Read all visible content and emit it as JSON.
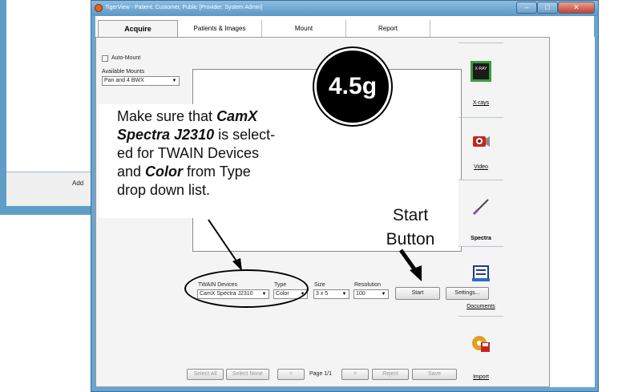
{
  "background_window": {
    "button_label": "Add"
  },
  "window": {
    "title": "TigerView - Patient: Customer, Public [Provider: System Admin]",
    "min": "–",
    "max": "□",
    "close": "✕"
  },
  "tabs": [
    "Acquire",
    "Patients & Images",
    "Mount",
    "Report"
  ],
  "left_panel": {
    "auto_mount": "Auto-Mount",
    "available_mounts_label": "Available Mounts",
    "available_mounts_value": "Pan and 4 BWX"
  },
  "controls": {
    "twain_label": "TWAIN Devices",
    "twain_value": "CamX Spectra J2310",
    "type_label": "Type",
    "type_value": "Color",
    "size_label": "Size",
    "size_value": "3 x 5",
    "resolution_label": "Resolution",
    "resolution_value": "100",
    "start": "Start",
    "settings": "Settings..."
  },
  "footer": {
    "select_all": "Select All",
    "select_none": "Select None",
    "prev": "<",
    "page": "Page 1/1",
    "next": ">",
    "reject": "Reject",
    "save": "Save"
  },
  "sidebar": {
    "xrays": "X-rays",
    "xray_icon_text": "X-RAY",
    "video": "Video",
    "spectra": "Spectra",
    "documents": "Documents",
    "import": "Import"
  },
  "annotation": {
    "badge": "4.5g",
    "lines": [
      [
        "Make sure that ",
        "CamX"
      ],
      [
        "Spectra J2310",
        " is select-"
      ],
      [
        "ed for TWAIN Devices",
        ""
      ],
      [
        "and ",
        "Color",
        " from Type"
      ],
      [
        "drop down list.",
        ""
      ]
    ],
    "line1_a": "Make sure that ",
    "line1_b": "CamX",
    "line2_a": "Spectra J2310",
    "line2_b": " is select-",
    "line3": "ed for TWAIN Devices",
    "line4_a": "and ",
    "line4_b": "Color",
    "line4_c": " from Type",
    "line5": "drop down list.",
    "start_line1": "Start",
    "start_line2": "Button"
  },
  "colors": {
    "window_frame": "#6aa4cf",
    "panel": "#f4f4f4",
    "close_button": "#c4412f"
  }
}
